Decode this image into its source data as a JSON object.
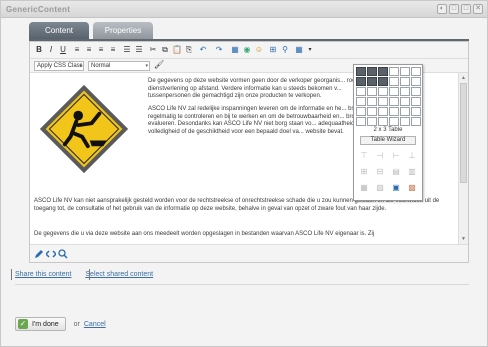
{
  "window": {
    "title": "GenericContent",
    "controls": [
      "◐",
      "□",
      "□",
      "✕"
    ]
  },
  "tabs": [
    {
      "label": "Content"
    },
    {
      "label": "Properties"
    }
  ],
  "toolbar": {
    "row1": [
      "B",
      "I",
      "U",
      "≡",
      "≡",
      "≡",
      "≡",
      "☰",
      "☰",
      "✂",
      "⧉",
      "📋",
      "⎘",
      "↶",
      "↷",
      "▦",
      "◉",
      "☺",
      "⊞",
      "⚲",
      "▦",
      "▾"
    ],
    "css_class_select": "Apply CSS Class",
    "format_select": "Normal",
    "brush_icon": "🖌"
  },
  "content": {
    "p1": "De gegevens op deze website vormen geen door de verkoper georganis... roep of dienstverlening op afstand. Verdere informatie kan u steeds bekomen v... tussenpersonen die gemachtigd zijn onze producten te verkopen.",
    "p2": "ASCO Life NV zal redelijke inspanningen leveren om de informatie en he... bsite regelmatig te controleren en bij te werken en om de betrouwbaarheid en... bronnen te evalueren. Desondanks kan ASCO Life NV niet borg staan vo... adequaatheid, volledigheid of de geschiktheid voor een bepaald doel va... website bevat.",
    "p3": "ASCO Life NV kan niet aansprakelijk gesteld worden voor de rechtstreekse of onrechtstreekse schade die u zou kunnen geleden en die voortvloeit uit de toegang tot, de consultatie of het gebruik van de informatie op deze website, behalve in geval van opzet of zware fout van haar zijde.",
    "p4": "De gegevens die u via deze website aan ons meedeelt worden opgeslagen in bestanden waarvan ASCO Life NV eigenaar is. Zij"
  },
  "popup": {
    "size_label": "2 x 3 Table",
    "wizard_label": "Table Wizard",
    "grid_rows": 6,
    "grid_cols": 6,
    "selected_rows": 2,
    "selected_cols": 3
  },
  "links": {
    "share": "Share this content",
    "select": "Select shared content"
  },
  "footer": {
    "done_label": "I'm done",
    "or_label": "or",
    "cancel_label": "Cancel"
  },
  "colors": {
    "accent": "#5f6871",
    "link": "#3b6ea5",
    "done_check": "#6aa84f"
  }
}
